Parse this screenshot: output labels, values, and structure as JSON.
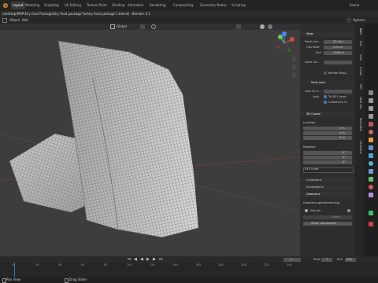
{
  "app": {
    "workspaces": [
      "Layout",
      "Modeling",
      "Sculpting",
      "UV Editing",
      "Texture Paint",
      "Shading",
      "Animation",
      "Rendering",
      "Compositing",
      "Geometry Nodes",
      "Scripting"
    ],
    "scene": "Scene"
  },
  "title": "\\desktop\\MRP\\Dry food Package\\Dry food package Turkey food package 1.blend] - Blender 4.1",
  "menu": [
    "Object",
    "Add",
    "Global",
    "Options"
  ],
  "viewport": {
    "orientation": "Global"
  },
  "npanel": {
    "view_section": "View",
    "focal_label": "Focal Len...",
    "focal_value": "50 mm",
    "clip_start_label": "Clip Start",
    "clip_start_value": "0.01 m",
    "clip_end_label": "End",
    "clip_end_value": "1000 m",
    "local_camera_label": "Local Ca...",
    "render_region": "Render Regi...",
    "view_lock_section": "View Lock",
    "lock_to_object_label": "Lock to O...",
    "lock_label": "Lock",
    "to_3d_cursor": "To 3D Cursor",
    "camera_to_view": "Camera to V...",
    "cursor_section": "3D Cursor",
    "location_label": "Location:",
    "loc_x": "0 m",
    "loc_y": "0 m",
    "loc_z": "0 m",
    "rotation_label": "Rotation:",
    "rot_x": "0°",
    "rot_y": "0°",
    "rot_z": "0°",
    "rotation_mode": "XYZ Euler",
    "collections": "Collections",
    "annotations": "Annotations",
    "geoscene_section": "Geoscene",
    "geoscene_label": "Geoscene georeferencing",
    "not_set": "Not set",
    "zoom_btn": "Zoom",
    "show_coords": "Show coordinates"
  },
  "vtabs": [
    "Item",
    "Tool",
    "View",
    "Create",
    "Edit",
    "Hard Ops",
    "BoxCutter",
    "Geoscene"
  ],
  "timeline": {
    "frame_current": "1",
    "start_label": "Start",
    "start_value": "1",
    "end_label": "End",
    "end_value": "250",
    "ticks": [
      "0",
      "20",
      "40",
      "60",
      "80",
      "100",
      "120",
      "140",
      "160",
      "180",
      "200",
      "220",
      "240"
    ]
  },
  "status": {
    "left": "Pan View",
    "right": "Drag Slider"
  },
  "colors": {
    "accent": "#4772b3",
    "viewport_bg": "#3d3d3d",
    "panel_bg": "#2d2d2d"
  }
}
